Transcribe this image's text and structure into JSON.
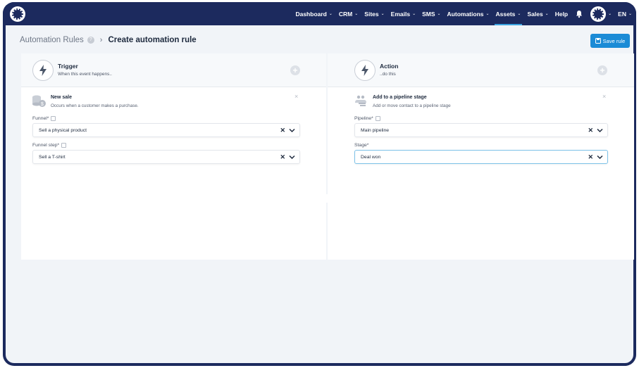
{
  "nav": {
    "items": [
      {
        "label": "Dashboard",
        "chevron": true
      },
      {
        "label": "CRM",
        "chevron": true
      },
      {
        "label": "Sites",
        "chevron": true
      },
      {
        "label": "Emails",
        "chevron": true
      },
      {
        "label": "SMS",
        "chevron": true
      },
      {
        "label": "Automations",
        "chevron": true
      },
      {
        "label": "Assets",
        "chevron": true,
        "active": true
      },
      {
        "label": "Sales",
        "chevron": true
      },
      {
        "label": "Help",
        "chevron": false
      }
    ],
    "language": "EN",
    "icons": [
      "logo-icon",
      "bell-icon",
      "avatar-icon",
      "chevron-down-icon"
    ]
  },
  "breadcrumb": {
    "root": "Automation Rules",
    "current": "Create automation rule"
  },
  "toolbar": {
    "save_label": "Save rule"
  },
  "trigger": {
    "title": "Trigger",
    "subtitle": "When this event happens..",
    "card_title": "New sale",
    "card_subtitle": "Occurs when a customer makes a purchase.",
    "funnel_label": "Funnel*",
    "funnel_value": "Sell a physical product",
    "step_label": "Funnel step*",
    "step_value": "Sell a T-shirt"
  },
  "action": {
    "title": "Action",
    "subtitle": "..do this",
    "card_title": "Add to a pipeline stage",
    "card_subtitle": "Add or move contact to a pipeline stage",
    "pipeline_label": "Pipeline*",
    "pipeline_value": "Main pipeline",
    "stage_label": "Stage*",
    "stage_value": "Deal won"
  },
  "glyphs": {
    "clear": "✕",
    "close": "×",
    "plus": "+",
    "sep": "›",
    "help": "?"
  },
  "colors": {
    "nav_bg": "#1c2a5e",
    "accent": "#1b8bd6",
    "page_bg": "#f1f4f8"
  }
}
